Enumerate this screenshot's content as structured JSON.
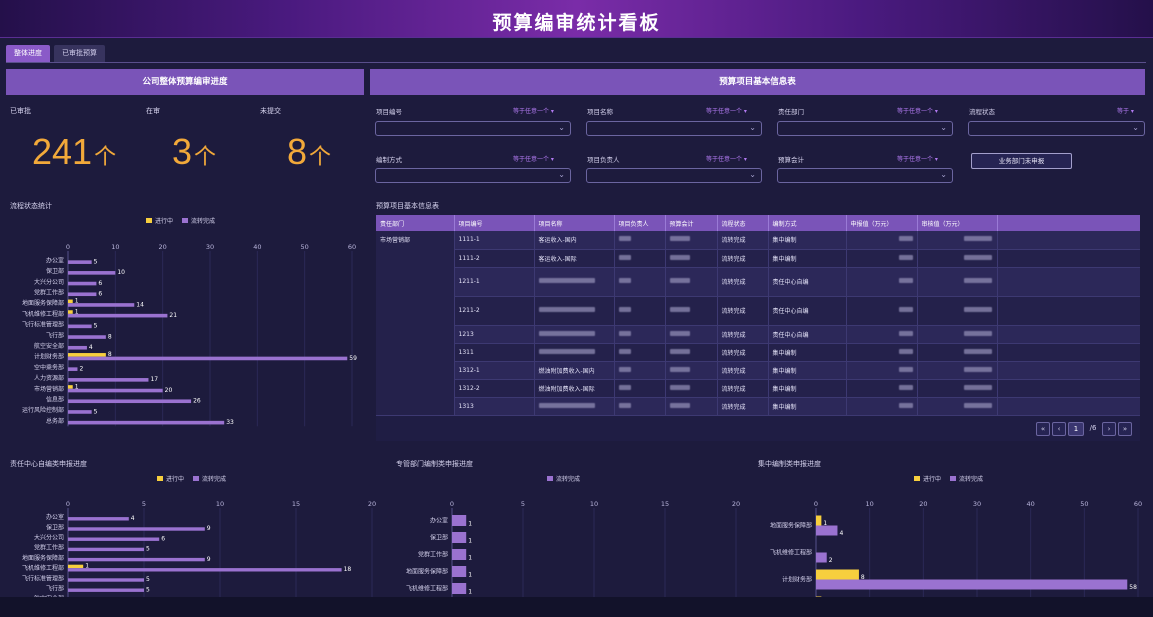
{
  "header": {
    "title": "预算编审统计看板"
  },
  "tabs": [
    {
      "label": "整体进度",
      "active": true
    },
    {
      "label": "已审批预算",
      "active": false
    }
  ],
  "progress_panel": {
    "title": "公司整体预算编审进度",
    "stats": [
      {
        "label": "已审批",
        "value": "241",
        "unit": "个"
      },
      {
        "label": "在审",
        "value": "3",
        "unit": "个"
      },
      {
        "label": "未提交",
        "value": "8",
        "unit": "个"
      }
    ]
  },
  "colors": {
    "in_progress": "#f7cf3e",
    "done": "#9a72d0",
    "accent": "#7a54b8",
    "number": "#f2a93a"
  },
  "info_panel": {
    "title": "预算项目基本信息表",
    "filters": [
      {
        "label": "项目编号",
        "op": "等于任意一个 ▾"
      },
      {
        "label": "项目名称",
        "op": "等于任意一个 ▾"
      },
      {
        "label": "责任部门",
        "op": "等于任意一个 ▾"
      },
      {
        "label": "流程状态",
        "op": "等于 ▾"
      },
      {
        "label": "编制方式",
        "op": "等于任意一个 ▾"
      },
      {
        "label": "项目负责人",
        "op": "等于任意一个 ▾"
      },
      {
        "label": "预算会计",
        "op": "等于任意一个 ▾"
      }
    ],
    "button": "业务部门未申报",
    "table_title": "预算项目基本信息表",
    "columns": [
      "责任部门",
      "项目编号",
      "项目名称",
      "项目负责人",
      "预算会计",
      "流程状态",
      "编制方式",
      "申报值（万元）",
      "审核值（万元）"
    ],
    "dept": "市场营销部",
    "rows": [
      {
        "code": "1111-1",
        "name": "客运收入-国内",
        "status": "流转完成",
        "mode": "集中编制",
        "tall": false
      },
      {
        "code": "1111-2",
        "name": "客运收入-国际",
        "status": "流转完成",
        "mode": "集中编制",
        "tall": false
      },
      {
        "code": "1211-1",
        "name": "",
        "status": "流转完成",
        "mode": "责任中心自编",
        "tall": true
      },
      {
        "code": "1211-2",
        "name": "",
        "status": "流转完成",
        "mode": "责任中心自编",
        "tall": true
      },
      {
        "code": "1213",
        "name": "",
        "status": "流转完成",
        "mode": "责任中心自编",
        "tall": false
      },
      {
        "code": "1311",
        "name": "",
        "status": "流转完成",
        "mode": "集中编制",
        "tall": false
      },
      {
        "code": "1312-1",
        "name": "燃油附加费收入-国内",
        "status": "流转完成",
        "mode": "集中编制",
        "tall": false
      },
      {
        "code": "1312-2",
        "name": "燃油附加费收入-国际",
        "status": "流转完成",
        "mode": "集中编制",
        "tall": false
      },
      {
        "code": "1313",
        "name": "",
        "status": "流转完成",
        "mode": "集中编制",
        "tall": false
      }
    ],
    "pager": {
      "current": "1",
      "total": "/6"
    }
  },
  "chart_data": [
    {
      "type": "bar",
      "title": "流程状态统计",
      "orientation": "horizontal",
      "categories": [
        "办公室",
        "保卫部",
        "大兴分公司",
        "党群工作部",
        "地面服务保障部",
        "飞机维修工程部",
        "飞行标准管理部",
        "飞行部",
        "航空安全部",
        "计划财务部",
        "空中乘务部",
        "人力资源部",
        "市场营销部",
        "信息部",
        "运行风险控制部",
        "总务部"
      ],
      "series": [
        {
          "name": "进行中",
          "values": [
            0,
            0,
            0,
            0,
            1,
            1,
            0,
            0,
            0,
            8,
            0,
            0,
            1,
            0,
            0,
            0
          ]
        },
        {
          "name": "流转完成",
          "values": [
            5,
            10,
            6,
            6,
            14,
            21,
            5,
            8,
            4,
            59,
            2,
            17,
            20,
            26,
            5,
            33
          ]
        }
      ],
      "xlim": [
        0,
        60
      ],
      "ticks": [
        0,
        10,
        20,
        30,
        40,
        50,
        60
      ],
      "legend": "top"
    },
    {
      "type": "bar",
      "title": "责任中心自编类申报进度",
      "orientation": "horizontal",
      "categories": [
        "办公室",
        "保卫部",
        "大兴分公司",
        "党群工作部",
        "地面服务保障部",
        "飞机维修工程部",
        "飞行标准管理部",
        "飞行部",
        "航空安全部"
      ],
      "series": [
        {
          "name": "进行中",
          "values": [
            0,
            0,
            0,
            0,
            0,
            1,
            0,
            0,
            0
          ]
        },
        {
          "name": "流转完成",
          "values": [
            4,
            9,
            6,
            5,
            9,
            18,
            5,
            5,
            4
          ]
        }
      ],
      "xlim": [
        0,
        20
      ],
      "ticks": [
        0,
        5,
        10,
        15,
        20
      ],
      "legend": "top"
    },
    {
      "type": "bar",
      "title": "专管部门编制类申报进度",
      "orientation": "horizontal",
      "categories": [
        "办公室",
        "保卫部",
        "党群工作部",
        "地面服务保障部",
        "飞机维修工程部"
      ],
      "series": [
        {
          "name": "流转完成",
          "values": [
            1,
            1,
            1,
            1,
            1
          ]
        }
      ],
      "xlim": [
        0,
        20
      ],
      "ticks": [
        0,
        5,
        10,
        15,
        20
      ],
      "legend": "top"
    },
    {
      "type": "bar",
      "title": "集中编制类申报进度",
      "orientation": "horizontal",
      "categories": [
        "地面服务保障部",
        "飞机维修工程部",
        "计划财务部",
        ""
      ],
      "series": [
        {
          "name": "进行中",
          "values": [
            1,
            0,
            8,
            1
          ]
        },
        {
          "name": "流转完成",
          "values": [
            4,
            2,
            58,
            0
          ]
        }
      ],
      "xlim": [
        0,
        60
      ],
      "ticks": [
        0,
        10,
        20,
        30,
        40,
        50,
        60
      ],
      "legend": "top"
    }
  ]
}
